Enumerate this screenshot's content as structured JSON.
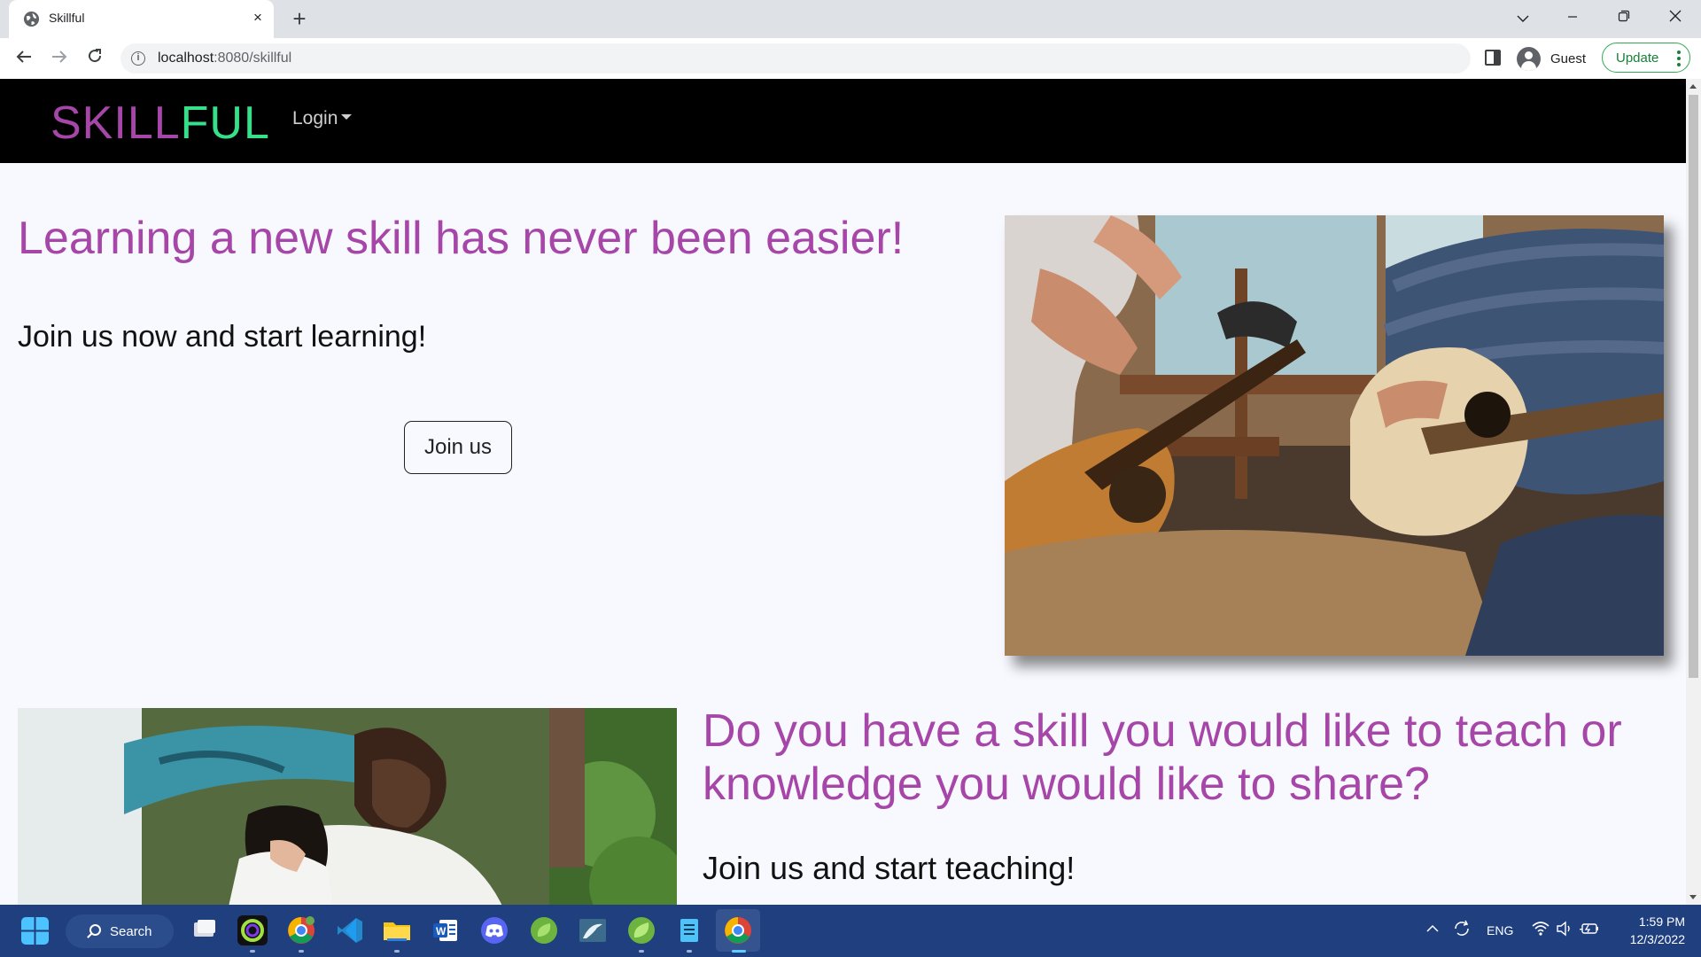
{
  "browser": {
    "tab_title": "Skillful",
    "tab_close": "×",
    "new_tab": "+",
    "url_host": "localhost",
    "url_rest": ":8080/skillful",
    "profile_label": "Guest",
    "update_label": "Update"
  },
  "site": {
    "brand_part1": "SKILL",
    "brand_part2": "FUL",
    "nav_login": "Login",
    "hero_title": "Learning a new skill has never been easier!",
    "hero_subtitle": "Join us now and start learning!",
    "join_button": "Join us",
    "teach_title": "Do you have a skill you would like to teach or knowledge you would like to share?",
    "teach_subtitle": "Join us and start teaching!"
  },
  "taskbar": {
    "search_label": "Search",
    "language": "ENG",
    "time": "1:59 PM",
    "date": "12/3/2022",
    "apps": [
      "windows-start-icon",
      "task-view-icon",
      "app-ring-icon",
      "chrome-icon",
      "vscode-icon",
      "file-explorer-icon",
      "word-icon",
      "discord-icon",
      "spring-icon",
      "mysql-icon",
      "spring-tools-icon",
      "notepad-icon",
      "chrome-active-icon"
    ]
  },
  "colors": {
    "brand_purple": "#a646a8",
    "brand_green": "#36e08a",
    "nav_bg": "#000000",
    "page_bg": "#f8f9fe",
    "taskbar_bg": "#1f3f7e"
  }
}
